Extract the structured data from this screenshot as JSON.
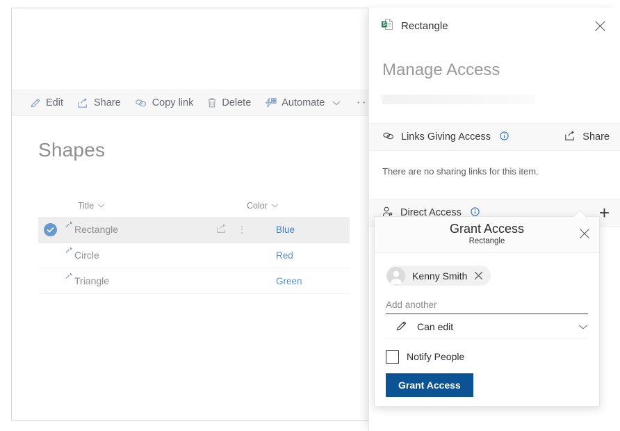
{
  "command_bar": {
    "items": [
      {
        "label": "Edit",
        "icon": "pencil-icon"
      },
      {
        "label": "Share",
        "icon": "share-icon"
      },
      {
        "label": "Copy link",
        "icon": "link-icon"
      },
      {
        "label": "Delete",
        "icon": "trash-icon"
      },
      {
        "label": "Automate",
        "icon": "automate-icon",
        "has_chevron": true
      }
    ],
    "overflow_label": "···"
  },
  "list": {
    "title": "Shapes",
    "columns": [
      {
        "label": "Title"
      },
      {
        "label": "Color"
      }
    ],
    "rows": [
      {
        "title": "Rectangle",
        "color": "Blue",
        "selected": true
      },
      {
        "title": "Circle",
        "color": "Red",
        "selected": false
      },
      {
        "title": "Triangle",
        "color": "Green",
        "selected": false
      }
    ]
  },
  "panel": {
    "item_name": "Rectangle",
    "item_icon": "excel-file-icon",
    "close_label": "Close",
    "heading": "Manage Access",
    "links_section": {
      "label": "Links Giving Access",
      "info_icon": "info-icon",
      "share_label": "Share",
      "empty_text": "There are no sharing links for this item."
    },
    "direct_section": {
      "label": "Direct Access",
      "info_icon": "info-icon",
      "add_label": "+"
    }
  },
  "callout": {
    "title": "Grant Access",
    "subtitle": "Rectangle",
    "close_label": "Close",
    "person": {
      "name": "Kenny Smith",
      "remove_label": "Remove"
    },
    "add_another_placeholder": "Add another",
    "permission": {
      "value": "Can edit",
      "icon": "pencil-icon"
    },
    "notify_label": "Notify People",
    "notify_checked": false,
    "submit_label": "Grant Access"
  },
  "colors": {
    "accent_blue": "#0b5394",
    "link_blue": "#5b8fc9",
    "checkbox_blue": "#6699cc",
    "excel_green": "#1a7a4c",
    "muted_text": "#8d8d8d"
  }
}
